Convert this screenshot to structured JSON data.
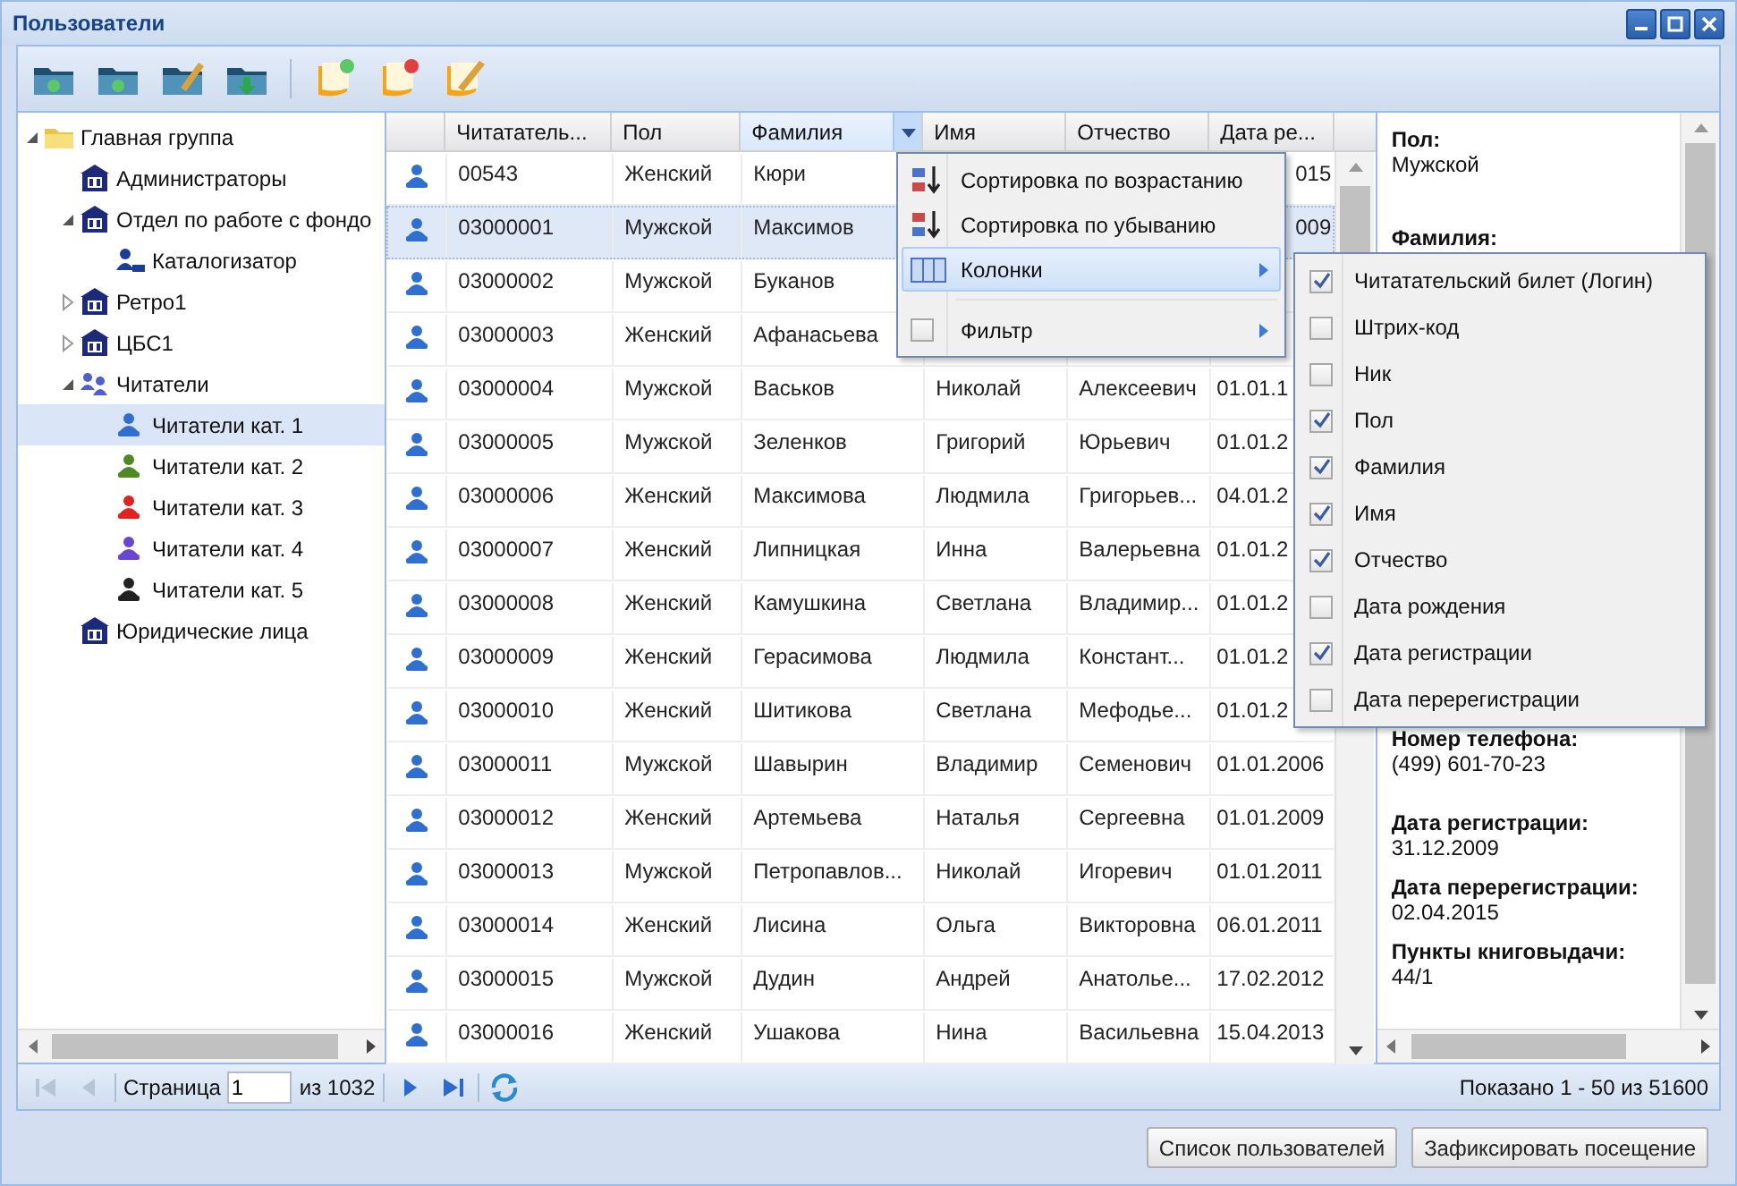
{
  "window": {
    "title": "Пользователи"
  },
  "tree": [
    {
      "label": "Главная группа",
      "kind": "folder",
      "expanded": true,
      "selected": false,
      "children": [
        {
          "label": "Администраторы",
          "kind": "department",
          "selected": false
        },
        {
          "label": "Отдел по работе с фондо",
          "kind": "department",
          "expanded": true,
          "selected": false,
          "children": [
            {
              "label": "Каталогизатор",
              "kind": "user",
              "selected": false
            }
          ]
        },
        {
          "label": "Ретро1",
          "kind": "department",
          "expanded": false,
          "selected": false
        },
        {
          "label": "ЦБС1",
          "kind": "department",
          "expanded": false,
          "selected": false
        },
        {
          "label": "Читатели",
          "kind": "group",
          "expanded": true,
          "selected": false,
          "children": [
            {
              "label": "Читатели кат. 1",
              "kind": "reader",
              "color": "#2f6fd0",
              "selected": true
            },
            {
              "label": "Читатели кат. 2",
              "kind": "reader",
              "color": "#4e8a24",
              "selected": false
            },
            {
              "label": "Читатели кат. 3",
              "kind": "reader",
              "color": "#e0231f",
              "selected": false
            },
            {
              "label": "Читатели кат. 4",
              "kind": "reader",
              "color": "#6a45d0",
              "selected": false
            },
            {
              "label": "Читатели кат. 5",
              "kind": "reader",
              "color": "#222222",
              "selected": false
            }
          ]
        },
        {
          "label": "Юридические лица",
          "kind": "department",
          "selected": false
        }
      ]
    }
  ],
  "grid": {
    "columns": [
      {
        "label": "Читататель...",
        "menu_open": false
      },
      {
        "label": "Пол",
        "menu_open": false
      },
      {
        "label": "Фамилия",
        "menu_open": true
      },
      {
        "label": "Имя",
        "menu_open": false
      },
      {
        "label": "Отчество",
        "menu_open": false
      },
      {
        "label": "Дата ре...",
        "menu_open": false
      }
    ],
    "rows": [
      {
        "card": "00543",
        "sex": "Женский",
        "surname": "Кюри",
        "date_tail": "015",
        "selected": false
      },
      {
        "card": "03000001",
        "sex": "Мужской",
        "surname": "Максимов",
        "date_tail": "009",
        "selected": true
      },
      {
        "card": "03000002",
        "sex": "Мужской",
        "surname": "Буканов",
        "selected": false
      },
      {
        "card": "03000003",
        "sex": "Женский",
        "surname": "Афанасьева",
        "selected": false
      },
      {
        "card": "03000004",
        "sex": "Мужской",
        "surname": "Васьков",
        "name": "Николай",
        "patronymic": "Алексеевич",
        "date": "01.01.1",
        "selected": false
      },
      {
        "card": "03000005",
        "sex": "Мужской",
        "surname": "Зеленков",
        "name": "Григорий",
        "patronymic": "Юрьевич",
        "date": "01.01.2",
        "selected": false
      },
      {
        "card": "03000006",
        "sex": "Женский",
        "surname": "Максимова",
        "name": "Людмила",
        "patronymic": "Григорьев...",
        "date": "04.01.2",
        "selected": false
      },
      {
        "card": "03000007",
        "sex": "Женский",
        "surname": "Липницкая",
        "name": "Инна",
        "patronymic": "Валерьевна",
        "date": "01.01.2",
        "selected": false
      },
      {
        "card": "03000008",
        "sex": "Женский",
        "surname": "Камушкина",
        "name": "Светлана",
        "patronymic": "Владимир...",
        "date": "01.01.2",
        "selected": false
      },
      {
        "card": "03000009",
        "sex": "Женский",
        "surname": "Герасимова",
        "name": "Людмила",
        "patronymic": "Констант...",
        "date": "01.01.2",
        "selected": false
      },
      {
        "card": "03000010",
        "sex": "Женский",
        "surname": "Шитикова",
        "name": "Светлана",
        "patronymic": "Мефодье...",
        "date": "01.01.2",
        "selected": false
      },
      {
        "card": "03000011",
        "sex": "Мужской",
        "surname": "Шавырин",
        "name": "Владимир",
        "patronymic": "Семенович",
        "date": "01.01.2006",
        "selected": false
      },
      {
        "card": "03000012",
        "sex": "Женский",
        "surname": "Артемьева",
        "name": "Наталья",
        "patronymic": "Сергеевна",
        "date": "01.01.2009",
        "selected": false
      },
      {
        "card": "03000013",
        "sex": "Мужской",
        "surname": "Петропавлов...",
        "name": "Николай",
        "patronymic": "Игоревич",
        "date": "01.01.2011",
        "selected": false
      },
      {
        "card": "03000014",
        "sex": "Женский",
        "surname": "Лисина",
        "name": "Ольга",
        "patronymic": "Викторовна",
        "date": "06.01.2011",
        "selected": false
      },
      {
        "card": "03000015",
        "sex": "Мужской",
        "surname": "Дудин",
        "name": "Андрей",
        "patronymic": "Анатолье...",
        "date": "17.02.2012",
        "selected": false
      },
      {
        "card": "03000016",
        "sex": "Женский",
        "surname": "Ушакова",
        "name": "Нина",
        "patronymic": "Васильевна",
        "date": "15.04.2013",
        "selected": false
      }
    ]
  },
  "column_menu": {
    "items": [
      {
        "kind": "sort_asc",
        "label": "Сортировка по возрастанию",
        "selected": false
      },
      {
        "kind": "sort_desc",
        "label": "Сортировка по убыванию",
        "selected": false
      },
      {
        "kind": "columns",
        "label": "Колонки",
        "selected": true
      },
      {
        "kind": "filter",
        "label": "Фильтр",
        "selected": false,
        "checked": false
      }
    ]
  },
  "columns_submenu": {
    "items": [
      {
        "label": "Читатательский билет (Логин)",
        "checked": true
      },
      {
        "label": "Штрих-код",
        "checked": false
      },
      {
        "label": "Ник",
        "checked": false
      },
      {
        "label": "Пол",
        "checked": true
      },
      {
        "label": "Фамилия",
        "checked": true
      },
      {
        "label": "Имя",
        "checked": true
      },
      {
        "label": "Отчество",
        "checked": true
      },
      {
        "label": "Дата рождения",
        "checked": false
      },
      {
        "label": "Дата регистрации",
        "checked": true
      },
      {
        "label": "Дата перерегистрации",
        "checked": false
      }
    ]
  },
  "details": {
    "fields": [
      {
        "label": "Пол:",
        "value": "Мужской"
      },
      {
        "label": "Фамилия:"
      },
      {
        "label": "Номер телефона:",
        "value": "(499) 601-70-23"
      },
      {
        "label": "Дата регистрации:",
        "value": "31.12.2009"
      },
      {
        "label": "Дата перерегистрации:",
        "value": "02.04.2015"
      },
      {
        "label": "Пункты книговыдачи:",
        "value": "44/1"
      }
    ]
  },
  "pager": {
    "back": [
      {
        "kind": "first",
        "disabled": true
      },
      {
        "kind": "prev",
        "disabled": true
      }
    ],
    "page_label": "Страница",
    "page": "1",
    "total": "из 1032",
    "forward": [
      {
        "kind": "next",
        "disabled": false
      },
      {
        "kind": "last",
        "disabled": false
      }
    ],
    "summary": "Показано 1 - 50 из 51600"
  },
  "actions": [
    "Список пользователей",
    "Зафиксировать посещение"
  ]
}
